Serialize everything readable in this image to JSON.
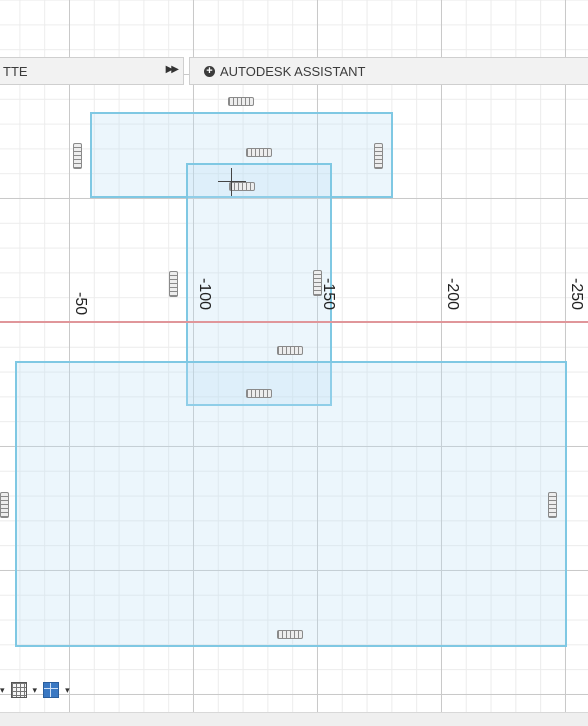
{
  "palette": {
    "label": "TTE",
    "collapse_icon": "double-chevron-right-icon",
    "collapse_glyph": "▶▶"
  },
  "assistant": {
    "label": "AUTODESK ASSISTANT",
    "icon": "plus-circle-icon",
    "icon_glyph": "+"
  },
  "ruler": {
    "labels": [
      "-50",
      "-100",
      "-150",
      "-200",
      "-250"
    ]
  },
  "colors": {
    "sketch_stroke": "#7fc8e3",
    "sketch_fill": "#badef5",
    "axis_line": "#e0969a",
    "toolbar_accent": "#3a78c3"
  },
  "toolbar": {
    "display_settings_icon": "display-settings-icon",
    "grid_icon": "grid-icon",
    "view_icon": "viewports-icon",
    "arrow_glyph": "▾"
  }
}
